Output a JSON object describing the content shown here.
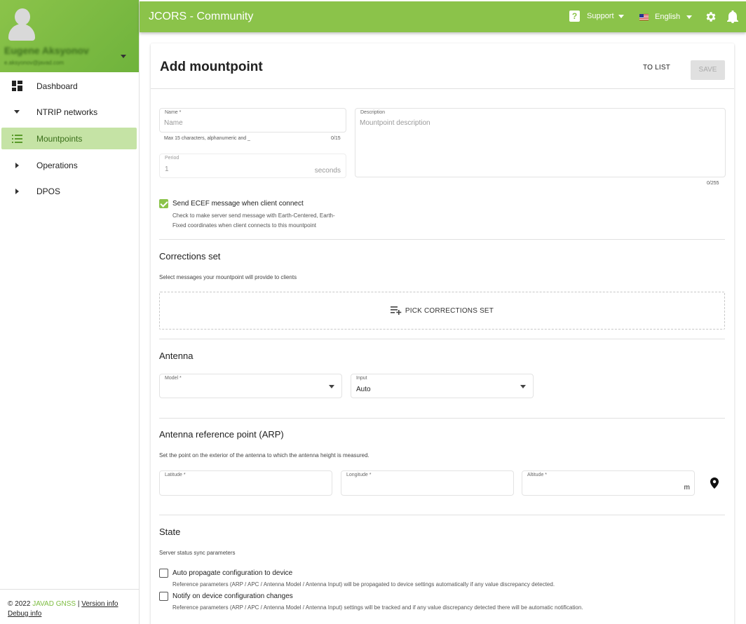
{
  "sidebar": {
    "user": {
      "name": "Eugene Aksyonov",
      "email": "e.aksyonov@javad.com"
    },
    "items": [
      {
        "label": "Dashboard",
        "icon": "dashboard-icon"
      },
      {
        "label": "NTRIP networks",
        "icon": "chevron-down-icon"
      },
      {
        "label": "Mountpoints",
        "icon": "list-icon",
        "active": true
      },
      {
        "label": "Operations",
        "icon": "chevron-right-icon"
      },
      {
        "label": "DPOS",
        "icon": "chevron-right-icon"
      }
    ],
    "footer": {
      "copyright": "© 2022",
      "brand": "JAVAD GNSS",
      "separator": "|",
      "version_link": "Version info",
      "debug_link": "Debug info"
    }
  },
  "topbar": {
    "title": "JCORS - Community",
    "support_label": "Support",
    "language_label": "English",
    "accent_color": "#8bc34a"
  },
  "page": {
    "title": "Add mountpoint",
    "to_list_label": "TO LIST",
    "save_label": "SAVE"
  },
  "form": {
    "name": {
      "label": "Name *",
      "placeholder": "Name",
      "hint": "Max 15 characters, alphanumeric and _",
      "counter": "0/15"
    },
    "description": {
      "label": "Description",
      "placeholder": "Mountpoint description",
      "counter": "0/255"
    },
    "period": {
      "label": "Period",
      "value": "1",
      "unit": "seconds"
    },
    "ecef": {
      "label": "Send ECEF message when client connect",
      "checked": true,
      "description_line1": "Check to make server send message with Earth-Centered, Earth-",
      "description_line2": "Fixed coordinates when client connects to this mountpoint"
    },
    "corrections": {
      "title": "Corrections set",
      "subtitle": "Select messages your mountpoint will provide to clients",
      "pick_label": "PICK CORRECTIONS SET"
    },
    "antenna": {
      "title": "Antenna",
      "model_label": "Model *",
      "model_value": "",
      "input_label": "Input",
      "input_value": "Auto"
    },
    "arp": {
      "title": "Antenna reference point (ARP)",
      "subtitle": "Set the point on the exterior of the antenna to which the antenna height is measured.",
      "latitude_label": "Latitude *",
      "longitude_label": "Longitude *",
      "altitude_label": "Altitude *",
      "altitude_unit": "m"
    },
    "state": {
      "title": "State",
      "subtitle": "Server status sync parameters",
      "auto_propagate": {
        "label": "Auto propagate configuration to device",
        "checked": false,
        "description": "Reference parameters (ARP / APC / Antenna Model / Antenna Input) will be propagated to device settings automatically if any value discrepancy detected."
      },
      "notify": {
        "label": "Notify on device configuration changes",
        "checked": false,
        "description": "Reference parameters (ARP / APC / Antenna Model / Antenna Input) settings will be tracked and if any value discrepancy detected there will be automatic notification."
      }
    }
  }
}
